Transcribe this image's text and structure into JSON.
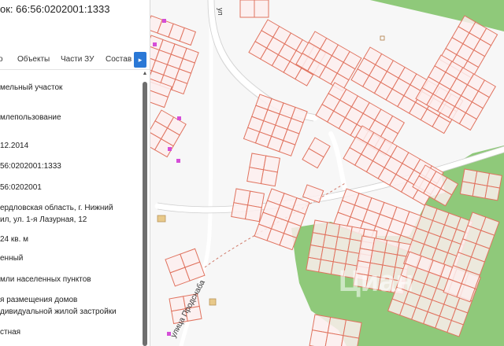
{
  "panel": {
    "title": "ок: 66:56:0202001:1333",
    "tabs": [
      {
        "label": "о"
      },
      {
        "label": "Объекты"
      },
      {
        "label": "Части ЗУ"
      },
      {
        "label": "Состав"
      }
    ],
    "values": [
      "мельный участок",
      "млепользование",
      "12.2014",
      "56:0202001:1333",
      "56:0202001",
      "ердловская область, г. Нижний",
      "ил, ул. 1-я Лазурная, 12",
      "24 кв. м",
      "енный",
      "мли населенных пунктов",
      "я размещения домов",
      "дивидуальной жилой застройки",
      "стная"
    ]
  },
  "map": {
    "street_label": "улица Продснаба",
    "street_label_top": "ул",
    "watermark": "Циан"
  },
  "colors": {
    "parcel_stroke": "#e0735f",
    "parcel_fill": "#fdeeee",
    "forest": "#8fc97a",
    "accent": "#2a78d6"
  }
}
